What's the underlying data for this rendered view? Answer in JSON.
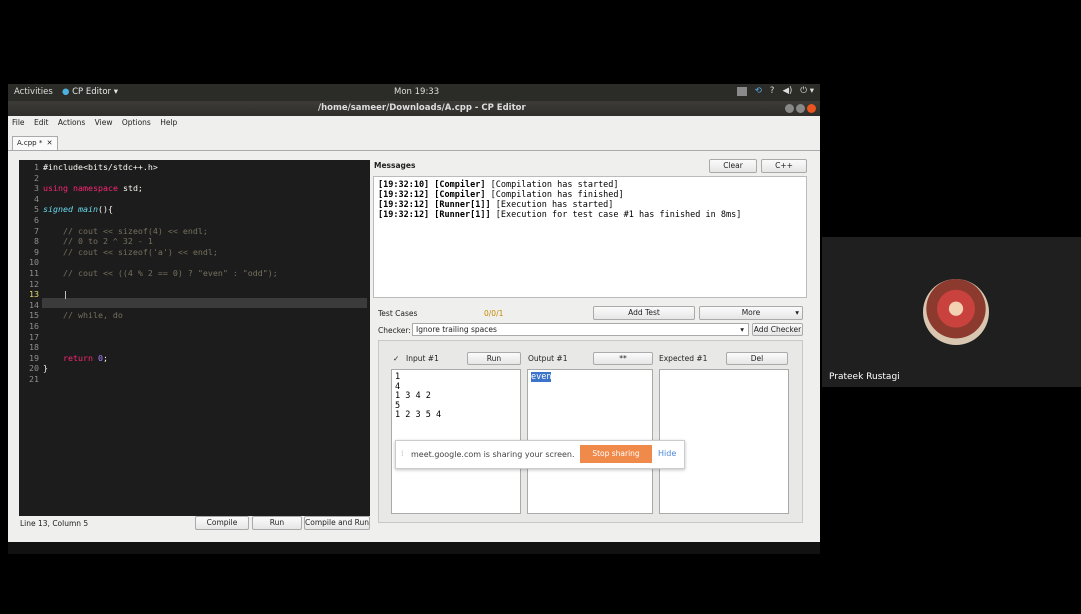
{
  "topbar": {
    "activities": "Activities",
    "app": "CP Editor ▾",
    "clock": "Mon 19:33"
  },
  "window": {
    "title": "/home/sameer/Downloads/A.cpp - CP Editor"
  },
  "menu": [
    "File",
    "Edit",
    "Actions",
    "View",
    "Options",
    "Help"
  ],
  "tab": {
    "label": "A.cpp *",
    "close": "✕"
  },
  "editor": {
    "line_numbers": [
      "1",
      "2",
      "3",
      "4",
      "5",
      "6",
      "7",
      "8",
      "9",
      "10",
      "11",
      "12",
      "13",
      "14",
      "15",
      "16",
      "17",
      "18",
      "19",
      "20",
      "21"
    ],
    "lines": [
      "#include<bits/stdc++.h>",
      "",
      "using namespace std;",
      "",
      "signed main(){",
      "",
      "    // cout << sizeof(4) << endl;",
      "    // 0 to 2 ^ 32 - 1",
      "    // cout << sizeof('a') << endl;",
      "",
      "    // cout << ((4 % 2 == 0) ? \"even\" : \"odd\");",
      "",
      "    |",
      "",
      "    // while, do",
      "",
      "",
      "",
      "    return 0;",
      "}",
      ""
    ]
  },
  "status": {
    "position": "Line 13, Column 5",
    "compile": "Compile",
    "run": "Run",
    "compile_and_run": "Compile and Run"
  },
  "messages": {
    "label": "Messages",
    "clear": "Clear",
    "lang": "C++",
    "lines": [
      {
        "time": "[19:32:10]",
        "tag": "[Compiler]",
        "text": " [Compilation has started]"
      },
      {
        "time": "[19:32:12]",
        "tag": "[Compiler]",
        "text": " [Compilation has finished]"
      },
      {
        "time": "[19:32:12]",
        "tag": "[Runner[1]]",
        "text": " [Execution has started]"
      },
      {
        "time": "[19:32:12]",
        "tag": "[Runner[1]]",
        "text": " [Execution for test case #1 has finished in 8ms]"
      }
    ]
  },
  "tests": {
    "label": "Test Cases",
    "counter": "0/0/1",
    "add_test": "Add Test",
    "more": "More",
    "checker_label": "Checker:",
    "checker_value": "Ignore trailing spaces",
    "add_checker": "Add Checker",
    "check": "✓",
    "input_label": "Input #1",
    "run": "Run",
    "output_label": "Output #1",
    "diff": "**",
    "expected_label": "Expected #1",
    "del": "Del",
    "input_value": "1\n4\n1 3 4 2\n5\n1 2 3 5 4",
    "output_value": "even",
    "expected_value": ""
  },
  "share": {
    "text": "meet.google.com is sharing your screen.",
    "stop": "Stop sharing",
    "hide": "Hide"
  },
  "participant": {
    "name": "Prateek Rustagi"
  },
  "colors": {
    "editor_bg": "#1c1c1c",
    "stop_button": "#f08a4b",
    "hide_link": "#4b87d6",
    "selection": "#3b74c8"
  }
}
